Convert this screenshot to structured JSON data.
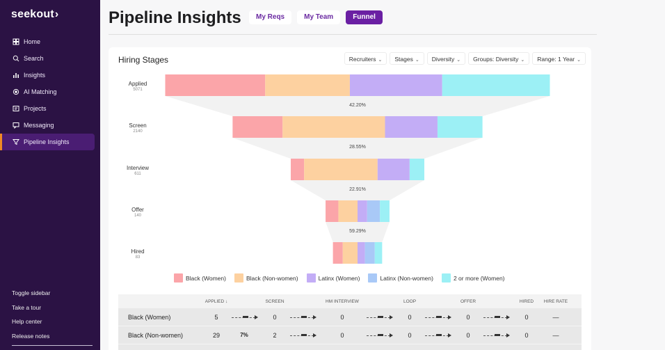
{
  "brand": {
    "logo": "seekout",
    "logo_chevron": "›"
  },
  "sidebar": {
    "items": [
      {
        "label": "Home",
        "icon": "home-icon"
      },
      {
        "label": "Search",
        "icon": "search-icon"
      },
      {
        "label": "Insights",
        "icon": "insights-icon"
      },
      {
        "label": "AI Matching",
        "icon": "ai-matching-icon"
      },
      {
        "label": "Projects",
        "icon": "projects-icon"
      },
      {
        "label": "Messaging",
        "icon": "messaging-icon"
      },
      {
        "label": "Pipeline Insights",
        "icon": "funnel-icon",
        "active": true
      }
    ],
    "bottom": [
      "Toggle sidebar",
      "Take a tour",
      "Help center",
      "Release notes"
    ]
  },
  "header": {
    "title": "Pipeline Insights",
    "tabs": [
      {
        "label": "My Reqs"
      },
      {
        "label": "My Team"
      },
      {
        "label": "Funnel",
        "active": true
      }
    ]
  },
  "card": {
    "title": "Hiring Stages",
    "filters": [
      "Recruiters",
      "Stages",
      "Diversity",
      "Groups: Diversity",
      "Range: 1 Year"
    ]
  },
  "colors": {
    "black_women": "#fba5a9",
    "black_non_women": "#fdd1a0",
    "latinx_women": "#c3adf6",
    "latinx_non_women": "#a9c9f7",
    "two_or_more_women": "#9cf0f5"
  },
  "funnel": {
    "stages": [
      {
        "label": "Applied",
        "count": "5071",
        "segments": [
          0.26,
          0.22,
          0.24,
          0.28
        ],
        "segment_keys": [
          "black_women",
          "black_non_women",
          "latinx_women",
          "two_or_more_women"
        ]
      },
      {
        "label": "Screen",
        "count": "2140",
        "segments": [
          0.2,
          0.41,
          0.21,
          0.18
        ],
        "segment_keys": [
          "black_women",
          "black_non_women",
          "latinx_women",
          "two_or_more_women"
        ]
      },
      {
        "label": "Interview",
        "count": "611",
        "segments": [
          0.1,
          0.55,
          0.24,
          0.11
        ],
        "segment_keys": [
          "black_women",
          "black_non_women",
          "latinx_women",
          "two_or_more_women"
        ]
      },
      {
        "label": "Offer",
        "count": "140",
        "segments": [
          0.2,
          0.3,
          0.15,
          0.2,
          0.15
        ],
        "segment_keys": [
          "black_women",
          "black_non_women",
          "latinx_women",
          "latinx_non_women",
          "two_or_more_women"
        ]
      },
      {
        "label": "Hired",
        "count": "83",
        "segments": [
          0.2,
          0.3,
          0.15,
          0.2,
          0.15
        ],
        "segment_keys": [
          "black_women",
          "black_non_women",
          "latinx_women",
          "latinx_non_women",
          "two_or_more_women"
        ]
      }
    ],
    "conversions": [
      "42.20%",
      "28.55%",
      "22.91%",
      "59.29%"
    ]
  },
  "legend": [
    {
      "label": "Black (Women)",
      "key": "black_women"
    },
    {
      "label": "Black (Non-women)",
      "key": "black_non_women"
    },
    {
      "label": "Latinx (Women)",
      "key": "latinx_women"
    },
    {
      "label": "Latinx (Non-women)",
      "key": "latinx_non_women"
    },
    {
      "label": "2 or more (Women)",
      "key": "two_or_more_women"
    }
  ],
  "table": {
    "headers": [
      "APPLIED ↓",
      "SCREEN",
      "HM INTERVIEW",
      "LOOP",
      "OFFER",
      "HIRED",
      "HIRE RATE"
    ],
    "rows": [
      {
        "name": "Black (Women)",
        "applied": "5",
        "r1": "",
        "screen": "0",
        "r2": "",
        "hm": "0",
        "r3": "",
        "loop": "0",
        "r4": "",
        "offer": "0",
        "r5": "",
        "hired": "0",
        "rate": "—"
      },
      {
        "name": "Black (Non-women)",
        "applied": "29",
        "r1": "7%",
        "screen": "2",
        "r2": "",
        "hm": "0",
        "r3": "",
        "loop": "0",
        "r4": "",
        "offer": "0",
        "r5": "",
        "hired": "0",
        "rate": "—"
      }
    ]
  }
}
